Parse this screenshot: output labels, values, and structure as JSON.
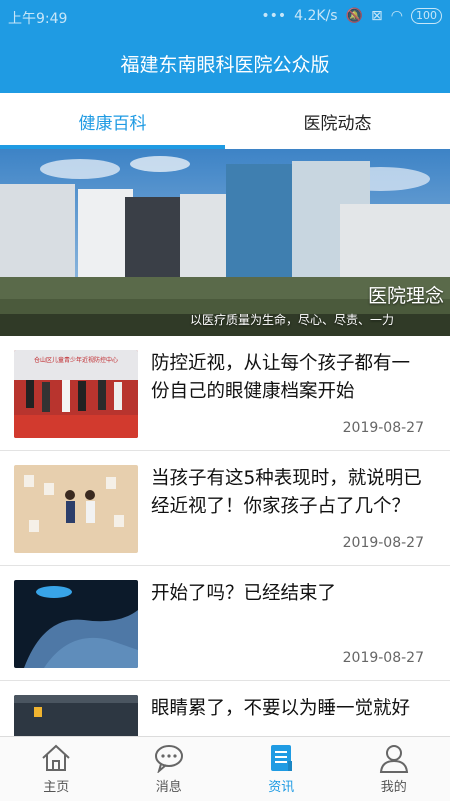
{
  "status_bar": {
    "time": "上午9:49",
    "speed": "4.2K/s",
    "battery": "100"
  },
  "header": {
    "title": "福建东南眼科医院公众版"
  },
  "tabs": [
    {
      "label": "健康百科",
      "active": true
    },
    {
      "label": "医院动态",
      "active": false
    }
  ],
  "banner": {
    "caption": "医院理念",
    "subcaption": "以医疗质量为生命，尽心、尽责、一力"
  },
  "articles": [
    {
      "title": "防控近视，从让每个孩子都有一份自己的眼健康档案开始",
      "date": "2019-08-27",
      "thumb_text": "仓山区儿童青少年近视防控中心"
    },
    {
      "title": "当孩子有这5种表现时，就说明已经近视了！你家孩子占了几个？",
      "date": "2019-08-27"
    },
    {
      "title": "开始了吗？已经结束了",
      "date": "2019-08-27"
    },
    {
      "title": "眼睛累了，不要以为睡一觉就好",
      "date": ""
    }
  ],
  "bottom_nav": [
    {
      "label": "主页",
      "icon": "home-icon",
      "active": false
    },
    {
      "label": "消息",
      "icon": "chat-bubble-icon",
      "active": false
    },
    {
      "label": "资讯",
      "icon": "document-icon",
      "active": true
    },
    {
      "label": "我的",
      "icon": "user-icon",
      "active": false
    }
  ],
  "colors": {
    "primary": "#1f9be3",
    "text": "#111111",
    "muted": "#666666"
  }
}
